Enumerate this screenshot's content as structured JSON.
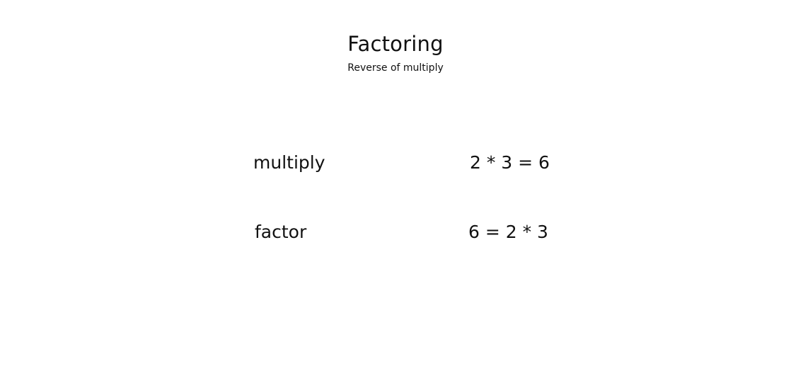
{
  "slide": {
    "title": "Factoring",
    "subtitle": "Reverse of multiply",
    "rows": [
      {
        "term": "multiply",
        "expression": "2 * 3 = 6"
      },
      {
        "term": "factor",
        "expression": "6 = 2 * 3"
      }
    ]
  }
}
